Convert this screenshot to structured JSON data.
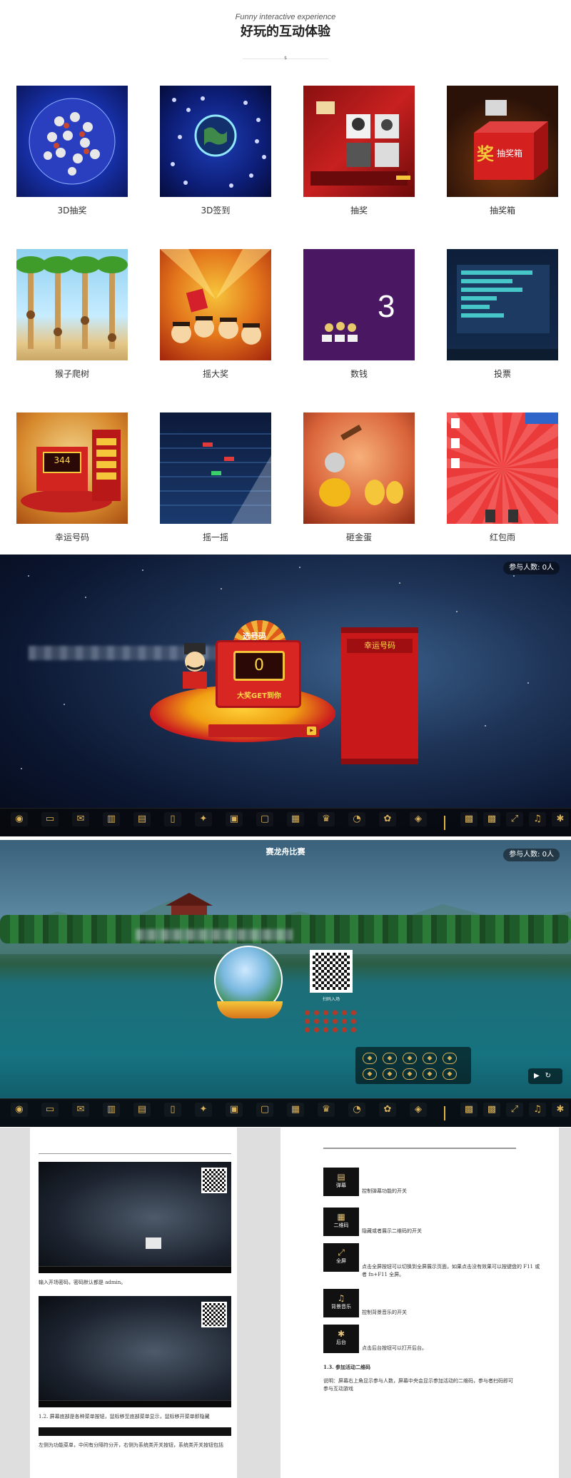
{
  "header": {
    "subtitle": "Funny interactive experience",
    "title": "好玩的互动体验",
    "divider_mark": "$"
  },
  "games": [
    {
      "label": "3D抽奖"
    },
    {
      "label": "3D签到"
    },
    {
      "label": "抽奖"
    },
    {
      "label": "抽奖箱"
    },
    {
      "label": "猴子爬树"
    },
    {
      "label": "摇大奖"
    },
    {
      "label": "数钱"
    },
    {
      "label": "投票"
    },
    {
      "label": "幸运号码"
    },
    {
      "label": "摇一摇"
    },
    {
      "label": "砸金蛋"
    },
    {
      "label": "红包雨"
    }
  ],
  "thumb_text": {
    "box_prize": "奖",
    "box_name": "抽奖箱",
    "money_count": "3",
    "lucky_number": "344"
  },
  "lucky_scene": {
    "participants": "参与人数: 0人",
    "wheel_label": "选号码",
    "machine_number": "0",
    "machine_caption": "大奖GET到你",
    "scroll_title": "幸运号码"
  },
  "boat_scene": {
    "title": "赛龙舟比赛",
    "participants": "参与人数: 0人",
    "qr_caption": "扫码入场"
  },
  "toolbar_icons": [
    "pin-icon",
    "chat-icon",
    "wechat-icon",
    "chart-icon",
    "sign-icon",
    "phone-icon",
    "handshake-icon",
    "image-icon",
    "door-icon",
    "calendar-icon",
    "trophy-icon",
    "pie-icon",
    "flower-icon",
    "gamepad-icon",
    "qr-icon",
    "qr-icon",
    "expand-icon",
    "music-icon",
    "gear-icon"
  ],
  "document": {
    "left_caption_1": "输入开场密码，密码默认都是 admin。",
    "left_caption_2": "1.2. 屏幕底部是各种菜单按钮，鼠标移至底部菜单显示，鼠标移开菜单即隐藏",
    "left_caption_3": "左侧为功能菜单，中间有分隔符分开，右侧为系统类开关按钮，系统类开关按钮包括",
    "right_items": [
      {
        "icon": "弹幕",
        "text": "控制弹幕功能的开关"
      },
      {
        "icon": "二维码",
        "text": "隐藏或者展示二维码的开关"
      },
      {
        "icon": "全屏",
        "text": "点击全屏按钮可以切换到全屏展示页面，如果点击没有效果可以按键盘的 F11 或者 fn+F11 全屏。"
      },
      {
        "icon": "背景音乐",
        "text": "控制背景音乐的开关"
      },
      {
        "icon": "后台",
        "text": "点击后台按钮可以打开后台。"
      }
    ],
    "right_heading": "1.3. 参加活动二维码",
    "right_para": "说明：屏幕右上角显示参与人数，屏幕中央会显示参加活动的二维码，参与者扫码即可参与互动游戏"
  },
  "colors": {
    "gold": "#d9b15a",
    "toolbar_bg": "#080a0e",
    "lucky_red": "#d82622"
  }
}
